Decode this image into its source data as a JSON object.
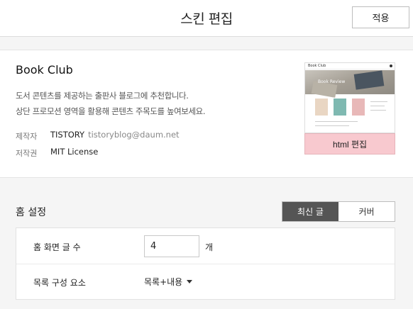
{
  "header": {
    "title": "스킨 편집",
    "apply_label": "적용"
  },
  "skin": {
    "name": "Book Club",
    "description_line1": "도서 콘텐츠를 제공하는 출판사 블로그에 추천합니다.",
    "description_line2": "상단 프로모션 영역을 활용해 콘텐츠 주목도를 높여보세요.",
    "maker_label": "제작자",
    "maker_name": "TISTORY",
    "maker_email": "tistoryblog@daum.net",
    "license_label": "저작권",
    "license_value": "MIT License",
    "html_edit_label": "html 편집",
    "accent_color": "#f8c9cf"
  },
  "thumbnail": {
    "logo_text": "Book Club",
    "hero_text": "Book Review"
  },
  "home": {
    "title": "홈 설정",
    "tabs": [
      {
        "label": "최신 글",
        "active": true
      },
      {
        "label": "커버",
        "active": false
      }
    ],
    "post_count_label": "홈 화면 글 수",
    "post_count_value": "4",
    "post_count_unit": "개",
    "list_config_label": "목록 구성 요소",
    "list_config_value": "목록+내용"
  }
}
